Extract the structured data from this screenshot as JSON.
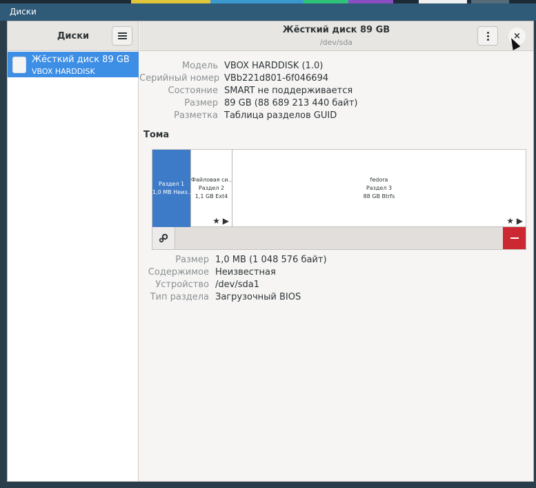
{
  "window_title": "Диски",
  "colors": {
    "accent": "#3d8ee5",
    "selected_partition": "#3d7bc9",
    "delete": "#cc2832",
    "titlebar": "#2f5a78",
    "top_segments": [
      "#e0c43a",
      "#3a9ad0",
      "#2fc37a",
      "#8a4dc2",
      "#f0f0f0",
      "#556b78"
    ]
  },
  "sidebar": {
    "title": "Диски",
    "menu_icon": "hamburger-icon",
    "disks": [
      {
        "name": "Жёсткий диск 89 GB",
        "model": "VBOX HARDDISK",
        "icon": "drive-icon"
      }
    ]
  },
  "header": {
    "title": "Жёсткий диск 89 GB",
    "subtitle": "/dev/sda",
    "more_icon": "kebab-icon",
    "close_label": "×"
  },
  "disk_info": [
    {
      "label": "Модель",
      "value": "VBOX HARDDISK (1.0)"
    },
    {
      "label": "Серийный номер",
      "value": "VBb221d801-6f046694"
    },
    {
      "label": "Состояние",
      "value": "SMART не поддерживается"
    },
    {
      "label": "Размер",
      "value": "89 GB (88 689 213 440 байт)"
    },
    {
      "label": "Разметка",
      "value": "Таблица разделов GUID"
    }
  ],
  "volumes": {
    "heading": "Тома",
    "partitions": [
      {
        "lines": [
          "Раздел 1",
          "1,0 MB Неиз..."
        ],
        "icons": "",
        "selected": true
      },
      {
        "lines": [
          "Файловая си...",
          "Раздел 2",
          "1,1 GB Ext4"
        ],
        "icons": "★ ▶",
        "selected": false
      },
      {
        "lines": [
          "fedora",
          "Раздел 3",
          "88 GB Btrfs"
        ],
        "icons": "★ ▶",
        "selected": false
      }
    ],
    "toolbar": {
      "settings_icon": "gears-icon",
      "delete_icon": "minus-icon"
    }
  },
  "partition_info": [
    {
      "label": "Размер",
      "value": "1,0 MB (1 048 576 байт)"
    },
    {
      "label": "Содержимое",
      "value": "Неизвестная"
    },
    {
      "label": "Устройство",
      "value": "/dev/sda1"
    },
    {
      "label": "Тип раздела",
      "value": "Загрузочный BIOS"
    }
  ]
}
